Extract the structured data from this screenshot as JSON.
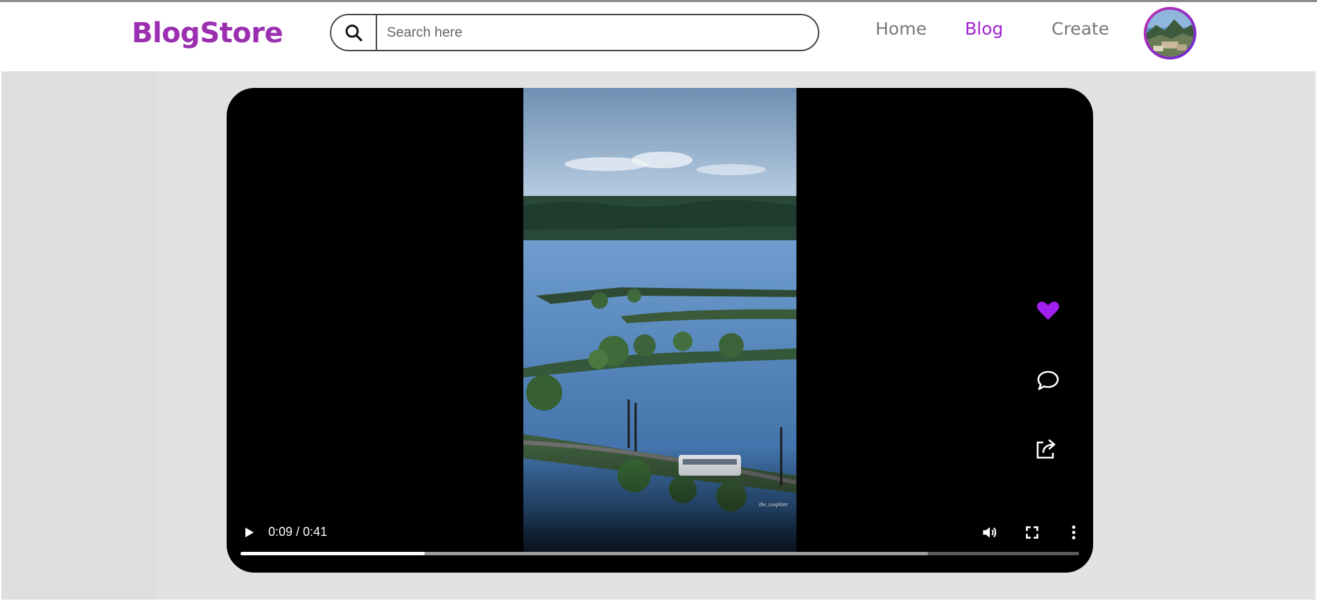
{
  "brand": {
    "name": "BlogStore",
    "color": "#9a2fb0"
  },
  "search": {
    "placeholder": "Search here",
    "value": "",
    "icon": "search-icon"
  },
  "nav": {
    "items": [
      {
        "label": "Home",
        "active": false
      },
      {
        "label": "Blog",
        "active": true
      },
      {
        "label": "Create",
        "active": false
      }
    ],
    "active_color": "#a020d6"
  },
  "user": {
    "avatar_icon": "avatar"
  },
  "video": {
    "current_time": "0:09",
    "duration": "0:41",
    "time_display": "0:09 / 0:41",
    "played_fraction": 0.22,
    "buffered_fraction": 0.82,
    "watermark": "the_coxplore",
    "controls": [
      "play-icon",
      "volume-icon",
      "fullscreen-icon",
      "more-options-icon"
    ]
  },
  "actions": {
    "like": {
      "icon": "heart-icon",
      "liked": true,
      "color": "#a020f0"
    },
    "comment": {
      "icon": "comment-icon"
    },
    "share": {
      "icon": "share-icon"
    }
  }
}
